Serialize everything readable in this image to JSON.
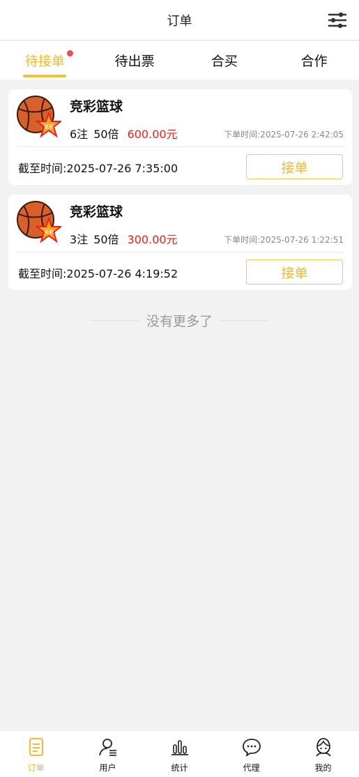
{
  "header": {
    "title": "订单",
    "filter_icon": "sliders-icon"
  },
  "tabs": [
    {
      "label": "待接单",
      "active": true,
      "has_dot": true
    },
    {
      "label": "待出票",
      "active": false
    },
    {
      "label": "合买",
      "active": false
    },
    {
      "label": "合作",
      "active": false
    }
  ],
  "orders": [
    {
      "game": "竞彩篮球",
      "notes": "6注",
      "multiple": "50倍",
      "amount": "600.00元",
      "order_time": "下单时间:2025-07-26 2:42:05",
      "deadline": "截至时间:2025-07-26 7:35:00",
      "action": "接单",
      "logo_text": "竞彩"
    },
    {
      "game": "竞彩篮球",
      "notes": "3注",
      "multiple": "50倍",
      "amount": "300.00元",
      "order_time": "下单时间:2025-07-26 1:22:51",
      "deadline": "截至时间:2025-07-26 4:19:52",
      "action": "接单",
      "logo_text": "竞彩"
    }
  ],
  "no_more": "没有更多了",
  "tabbar": [
    {
      "label": "订单",
      "icon": "order-icon",
      "active": true
    },
    {
      "label": "用户",
      "icon": "user-icon",
      "active": false
    },
    {
      "label": "统计",
      "icon": "stats-icon",
      "active": false
    },
    {
      "label": "代理",
      "icon": "agent-chat-icon",
      "active": false
    },
    {
      "label": "我的",
      "icon": "profile-icon",
      "active": false
    }
  ],
  "colors": {
    "accent": "#f5b82e",
    "amount": "#e8221c",
    "dot": "#e84c4c"
  }
}
